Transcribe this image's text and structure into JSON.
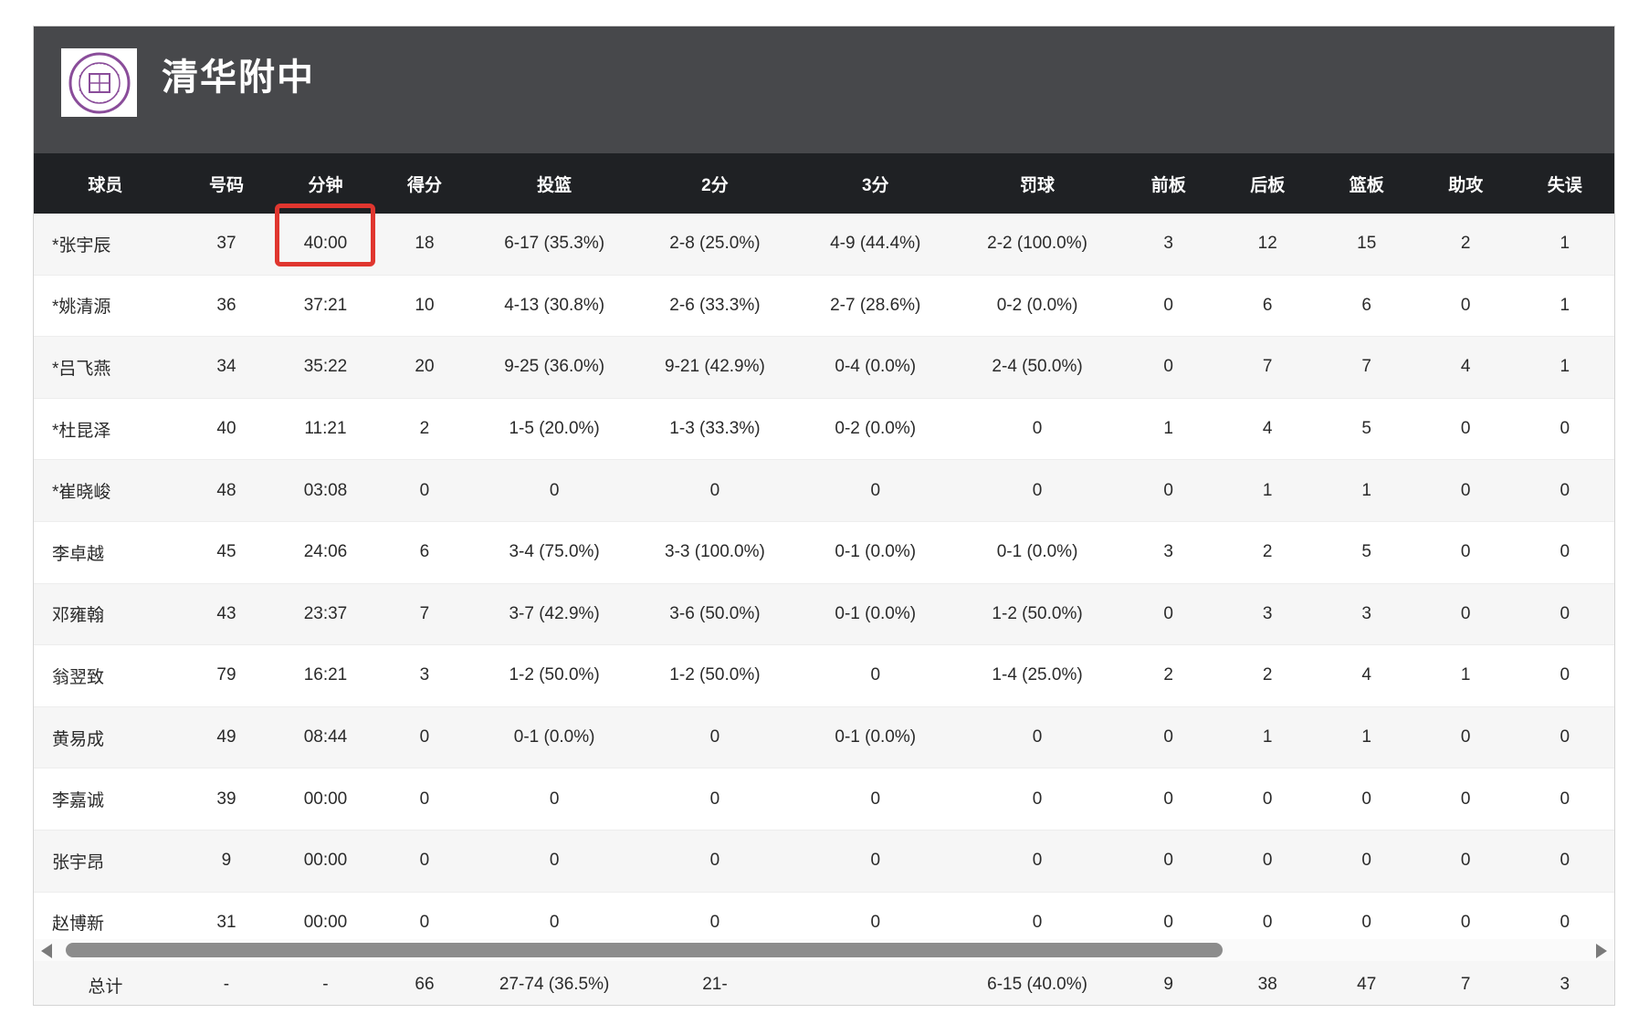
{
  "team": {
    "name": "清华附中",
    "logo_icon": "school-seal-icon",
    "logo_color": "#8a4d9a"
  },
  "columns": [
    "球员",
    "号码",
    "分钟",
    "得分",
    "投篮",
    "2分",
    "3分",
    "罚球",
    "前板",
    "后板",
    "篮板",
    "助攻",
    "失误"
  ],
  "rows": [
    [
      "*张宇辰",
      "37",
      "40:00",
      "18",
      "6-17 (35.3%)",
      "2-8 (25.0%)",
      "4-9 (44.4%)",
      "2-2 (100.0%)",
      "3",
      "12",
      "15",
      "2",
      "1"
    ],
    [
      "*姚清源",
      "36",
      "37:21",
      "10",
      "4-13 (30.8%)",
      "2-6 (33.3%)",
      "2-7 (28.6%)",
      "0-2 (0.0%)",
      "0",
      "6",
      "6",
      "0",
      "1"
    ],
    [
      "*吕飞燕",
      "34",
      "35:22",
      "20",
      "9-25 (36.0%)",
      "9-21 (42.9%)",
      "0-4 (0.0%)",
      "2-4 (50.0%)",
      "0",
      "7",
      "7",
      "4",
      "1"
    ],
    [
      "*杜昆泽",
      "40",
      "11:21",
      "2",
      "1-5 (20.0%)",
      "1-3 (33.3%)",
      "0-2 (0.0%)",
      "0",
      "1",
      "4",
      "5",
      "0",
      "0"
    ],
    [
      "*崔晓峻",
      "48",
      "03:08",
      "0",
      "0",
      "0",
      "0",
      "0",
      "0",
      "1",
      "1",
      "0",
      "0"
    ],
    [
      "李卓越",
      "45",
      "24:06",
      "6",
      "3-4 (75.0%)",
      "3-3 (100.0%)",
      "0-1 (0.0%)",
      "0-1 (0.0%)",
      "3",
      "2",
      "5",
      "0",
      "0"
    ],
    [
      "邓雍翰",
      "43",
      "23:37",
      "7",
      "3-7 (42.9%)",
      "3-6 (50.0%)",
      "0-1 (0.0%)",
      "1-2 (50.0%)",
      "0",
      "3",
      "3",
      "0",
      "0"
    ],
    [
      "翁翌致",
      "79",
      "16:21",
      "3",
      "1-2 (50.0%)",
      "1-2 (50.0%)",
      "0",
      "1-4 (25.0%)",
      "2",
      "2",
      "4",
      "1",
      "0"
    ],
    [
      "黄易成",
      "49",
      "08:44",
      "0",
      "0-1 (0.0%)",
      "0",
      "0-1 (0.0%)",
      "0",
      "0",
      "1",
      "1",
      "0",
      "0"
    ],
    [
      "李嘉诚",
      "39",
      "00:00",
      "0",
      "0",
      "0",
      "0",
      "0",
      "0",
      "0",
      "0",
      "0",
      "0"
    ],
    [
      "张宇昂",
      "9",
      "00:00",
      "0",
      "0",
      "0",
      "0",
      "0",
      "0",
      "0",
      "0",
      "0",
      "0"
    ],
    [
      "赵博新",
      "31",
      "00:00",
      "0",
      "0",
      "0",
      "0",
      "0",
      "0",
      "0",
      "0",
      "0",
      "0"
    ]
  ],
  "totals": [
    "总计",
    "-",
    "-",
    "66",
    "27-74 (36.5%)",
    "21-",
    "",
    "6-15 (40.0%)",
    "9",
    "38",
    "47",
    "7",
    "3"
  ],
  "highlight_color": "#e0362f",
  "header_bg": "#47484b",
  "table_header_bg": "#1f2124"
}
